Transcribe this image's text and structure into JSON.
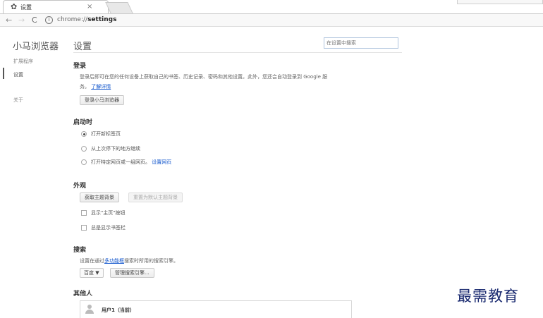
{
  "tab": {
    "title": "设置",
    "close": "×"
  },
  "toolbar": {
    "back": "←",
    "forward": "→",
    "reload": "C",
    "info": "i",
    "url_scheme": "chrome://",
    "url_path": "settings"
  },
  "sidebar": {
    "brand": "小马浏览器",
    "items": [
      {
        "label": "扩展程序"
      },
      {
        "label": "设置"
      },
      {
        "label": "关于"
      }
    ]
  },
  "main": {
    "title": "设置",
    "search_placeholder": "在设置中搜索"
  },
  "signin": {
    "heading": "登录",
    "desc_line1": "登录后即可在您的任何设备上获取自己的书签、历史记录、密码和其他设置。此外，您还会自动登录到 Google 服",
    "desc_line2": "务。",
    "learn_more": "了解详情",
    "button": "登录小马浏览器"
  },
  "startup": {
    "heading": "启动时",
    "options": [
      {
        "label": "打开新标签页"
      },
      {
        "label": "从上次停下的地方继续"
      },
      {
        "label": "打开特定网页或一组网页。"
      }
    ],
    "set_pages": "设置网页",
    "selected_index": 0
  },
  "appearance": {
    "heading": "外观",
    "get_themes": "获取主题背景",
    "reset_theme": "重置为默认主题背景",
    "show_home": "显示\"主页\"按钮",
    "show_bookmarks": "总是显示书签栏"
  },
  "search": {
    "heading": "搜索",
    "desc_before": "设置在通过",
    "omnibox_link": "多功能框",
    "desc_after": "搜索时所用的搜索引擎。",
    "engine": "百度",
    "manage": "管理搜索引擎..."
  },
  "people": {
    "heading": "其他人",
    "current_user": "用户1（当前）"
  },
  "watermark": "最需教育"
}
